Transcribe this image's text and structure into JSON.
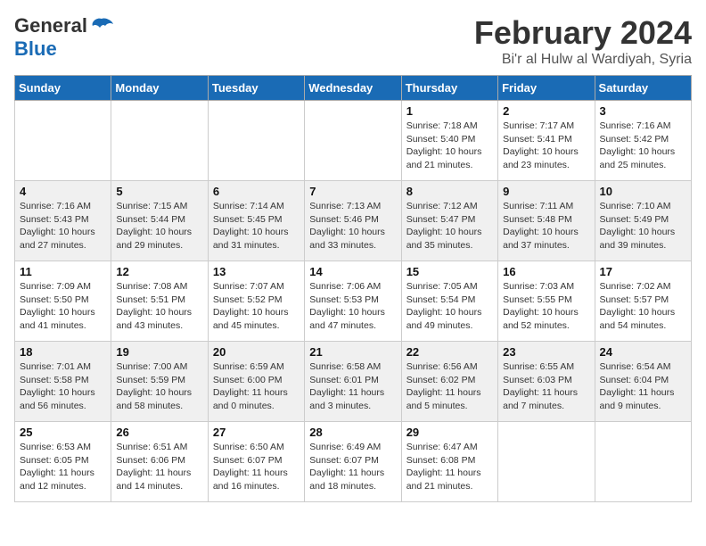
{
  "header": {
    "logo_line1": "General",
    "logo_line2": "Blue",
    "month": "February 2024",
    "location": "Bi'r al Hulw al Wardiyah, Syria"
  },
  "weekdays": [
    "Sunday",
    "Monday",
    "Tuesday",
    "Wednesday",
    "Thursday",
    "Friday",
    "Saturday"
  ],
  "weeks": [
    [
      {
        "day": "",
        "info": ""
      },
      {
        "day": "",
        "info": ""
      },
      {
        "day": "",
        "info": ""
      },
      {
        "day": "",
        "info": ""
      },
      {
        "day": "1",
        "info": "Sunrise: 7:18 AM\nSunset: 5:40 PM\nDaylight: 10 hours\nand 21 minutes."
      },
      {
        "day": "2",
        "info": "Sunrise: 7:17 AM\nSunset: 5:41 PM\nDaylight: 10 hours\nand 23 minutes."
      },
      {
        "day": "3",
        "info": "Sunrise: 7:16 AM\nSunset: 5:42 PM\nDaylight: 10 hours\nand 25 minutes."
      }
    ],
    [
      {
        "day": "4",
        "info": "Sunrise: 7:16 AM\nSunset: 5:43 PM\nDaylight: 10 hours\nand 27 minutes."
      },
      {
        "day": "5",
        "info": "Sunrise: 7:15 AM\nSunset: 5:44 PM\nDaylight: 10 hours\nand 29 minutes."
      },
      {
        "day": "6",
        "info": "Sunrise: 7:14 AM\nSunset: 5:45 PM\nDaylight: 10 hours\nand 31 minutes."
      },
      {
        "day": "7",
        "info": "Sunrise: 7:13 AM\nSunset: 5:46 PM\nDaylight: 10 hours\nand 33 minutes."
      },
      {
        "day": "8",
        "info": "Sunrise: 7:12 AM\nSunset: 5:47 PM\nDaylight: 10 hours\nand 35 minutes."
      },
      {
        "day": "9",
        "info": "Sunrise: 7:11 AM\nSunset: 5:48 PM\nDaylight: 10 hours\nand 37 minutes."
      },
      {
        "day": "10",
        "info": "Sunrise: 7:10 AM\nSunset: 5:49 PM\nDaylight: 10 hours\nand 39 minutes."
      }
    ],
    [
      {
        "day": "11",
        "info": "Sunrise: 7:09 AM\nSunset: 5:50 PM\nDaylight: 10 hours\nand 41 minutes."
      },
      {
        "day": "12",
        "info": "Sunrise: 7:08 AM\nSunset: 5:51 PM\nDaylight: 10 hours\nand 43 minutes."
      },
      {
        "day": "13",
        "info": "Sunrise: 7:07 AM\nSunset: 5:52 PM\nDaylight: 10 hours\nand 45 minutes."
      },
      {
        "day": "14",
        "info": "Sunrise: 7:06 AM\nSunset: 5:53 PM\nDaylight: 10 hours\nand 47 minutes."
      },
      {
        "day": "15",
        "info": "Sunrise: 7:05 AM\nSunset: 5:54 PM\nDaylight: 10 hours\nand 49 minutes."
      },
      {
        "day": "16",
        "info": "Sunrise: 7:03 AM\nSunset: 5:55 PM\nDaylight: 10 hours\nand 52 minutes."
      },
      {
        "day": "17",
        "info": "Sunrise: 7:02 AM\nSunset: 5:57 PM\nDaylight: 10 hours\nand 54 minutes."
      }
    ],
    [
      {
        "day": "18",
        "info": "Sunrise: 7:01 AM\nSunset: 5:58 PM\nDaylight: 10 hours\nand 56 minutes."
      },
      {
        "day": "19",
        "info": "Sunrise: 7:00 AM\nSunset: 5:59 PM\nDaylight: 10 hours\nand 58 minutes."
      },
      {
        "day": "20",
        "info": "Sunrise: 6:59 AM\nSunset: 6:00 PM\nDaylight: 11 hours\nand 0 minutes."
      },
      {
        "day": "21",
        "info": "Sunrise: 6:58 AM\nSunset: 6:01 PM\nDaylight: 11 hours\nand 3 minutes."
      },
      {
        "day": "22",
        "info": "Sunrise: 6:56 AM\nSunset: 6:02 PM\nDaylight: 11 hours\nand 5 minutes."
      },
      {
        "day": "23",
        "info": "Sunrise: 6:55 AM\nSunset: 6:03 PM\nDaylight: 11 hours\nand 7 minutes."
      },
      {
        "day": "24",
        "info": "Sunrise: 6:54 AM\nSunset: 6:04 PM\nDaylight: 11 hours\nand 9 minutes."
      }
    ],
    [
      {
        "day": "25",
        "info": "Sunrise: 6:53 AM\nSunset: 6:05 PM\nDaylight: 11 hours\nand 12 minutes."
      },
      {
        "day": "26",
        "info": "Sunrise: 6:51 AM\nSunset: 6:06 PM\nDaylight: 11 hours\nand 14 minutes."
      },
      {
        "day": "27",
        "info": "Sunrise: 6:50 AM\nSunset: 6:07 PM\nDaylight: 11 hours\nand 16 minutes."
      },
      {
        "day": "28",
        "info": "Sunrise: 6:49 AM\nSunset: 6:07 PM\nDaylight: 11 hours\nand 18 minutes."
      },
      {
        "day": "29",
        "info": "Sunrise: 6:47 AM\nSunset: 6:08 PM\nDaylight: 11 hours\nand 21 minutes."
      },
      {
        "day": "",
        "info": ""
      },
      {
        "day": "",
        "info": ""
      }
    ]
  ]
}
